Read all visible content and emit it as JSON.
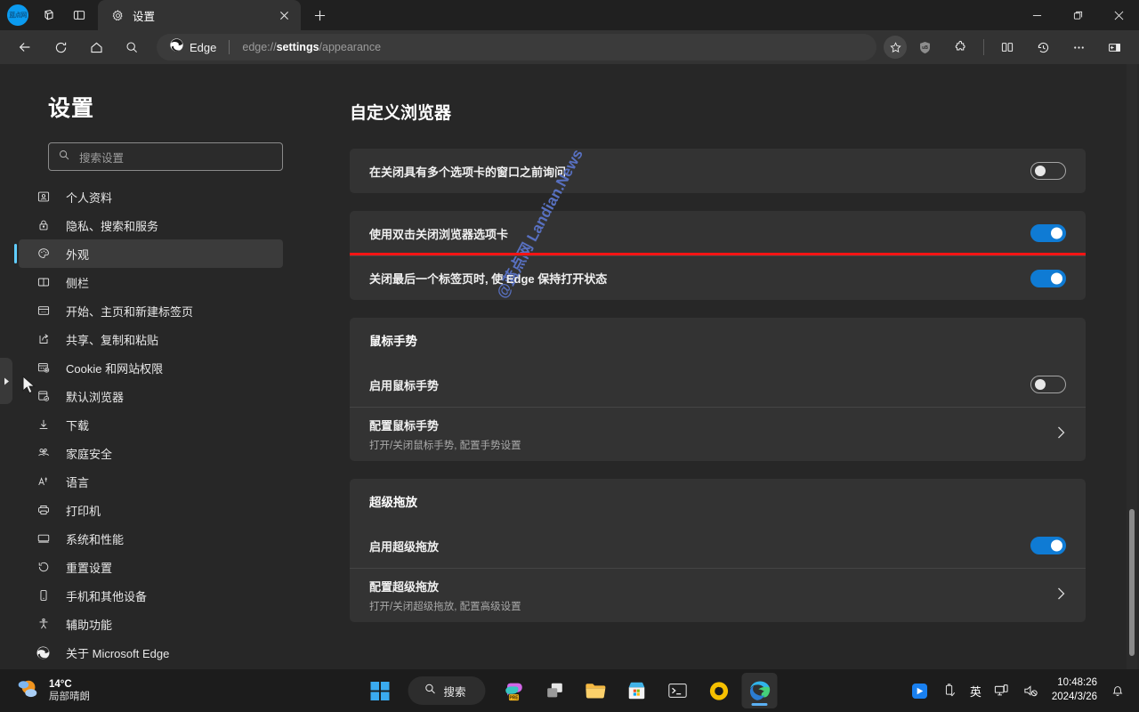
{
  "window": {
    "tab": {
      "title": "设置",
      "favicon_icon": "gear-icon",
      "close_icon": "close-icon"
    },
    "new_tab_icon": "plus-icon",
    "workspaces_icon": "workspaces-icon",
    "tab_actions_icon": "tab-actions-icon",
    "avatar_text": "蓝点网",
    "controls": {
      "minimize": "minimize-icon",
      "maximize": "maximize-icon",
      "close": "close-icon"
    }
  },
  "toolbar": {
    "back_icon": "back-arrow-icon",
    "refresh_icon": "refresh-icon",
    "home_icon": "home-icon",
    "search_icon": "search-icon",
    "omnibox": {
      "badge_icon": "edge-logo-icon",
      "badge_text": "Edge",
      "url_prefix": "edge://",
      "url_bold": "settings",
      "url_suffix": "/appearance",
      "favorite_icon": "star-icon"
    },
    "right_icons": [
      {
        "name": "ublock-icon",
        "label": "uB"
      },
      {
        "name": "extensions-puzzle-icon",
        "label": ""
      },
      {
        "name": "split-screen-icon",
        "label": ""
      },
      {
        "name": "history-icon",
        "label": ""
      },
      {
        "name": "more-options-icon",
        "label": ""
      },
      {
        "name": "sidebar-toggle-icon",
        "label": ""
      }
    ]
  },
  "sidebar": {
    "title": "设置",
    "search": {
      "placeholder": "搜索设置",
      "value": "",
      "icon": "search-icon"
    },
    "items": [
      {
        "label": "个人资料",
        "icon": "profile-icon",
        "active": false
      },
      {
        "label": "隐私、搜索和服务",
        "icon": "lock-icon",
        "active": false
      },
      {
        "label": "外观",
        "icon": "palette-icon",
        "active": true
      },
      {
        "label": "侧栏",
        "icon": "sidebar-panel-icon",
        "active": false
      },
      {
        "label": "开始、主页和新建标签页",
        "icon": "start-home-icon",
        "active": false
      },
      {
        "label": "共享、复制和粘贴",
        "icon": "share-icon",
        "active": false
      },
      {
        "label": "Cookie 和网站权限",
        "icon": "cookie-settings-icon",
        "active": false
      },
      {
        "label": "默认浏览器",
        "icon": "default-browser-icon",
        "active": false
      },
      {
        "label": "下载",
        "icon": "download-icon",
        "active": false
      },
      {
        "label": "家庭安全",
        "icon": "family-safety-icon",
        "active": false
      },
      {
        "label": "语言",
        "icon": "language-icon",
        "active": false
      },
      {
        "label": "打印机",
        "icon": "printer-icon",
        "active": false
      },
      {
        "label": "系统和性能",
        "icon": "system-performance-icon",
        "active": false
      },
      {
        "label": "重置设置",
        "icon": "reset-icon",
        "active": false
      },
      {
        "label": "手机和其他设备",
        "icon": "phone-devices-icon",
        "active": false
      },
      {
        "label": "辅助功能",
        "icon": "accessibility-icon",
        "active": false
      },
      {
        "label": "关于 Microsoft Edge",
        "icon": "edge-logo-icon",
        "active": false
      }
    ],
    "flyout_icon": "chevron-right-icon"
  },
  "main": {
    "title": "自定义浏览器",
    "watermark": "@蓝点网 Landian.News",
    "cards": [
      {
        "rows": [
          {
            "type": "toggle",
            "label": "在关闭具有多个选项卡的窗口之前询问",
            "state": "off",
            "highlight": false
          }
        ]
      },
      {
        "rows": [
          {
            "type": "toggle",
            "label": "使用双击关闭浏览器选项卡",
            "state": "on",
            "highlight": false
          },
          {
            "type": "toggle",
            "label": "关闭最后一个标签页时, 使 Edge 保持打开状态",
            "state": "on",
            "highlight": true
          }
        ]
      },
      {
        "rows": [
          {
            "type": "header",
            "label": "鼠标手势"
          },
          {
            "type": "toggle",
            "label": "启用鼠标手势",
            "state": "off",
            "highlight": false
          },
          {
            "type": "link",
            "label": "配置鼠标手势",
            "sublabel": "打开/关闭鼠标手势, 配置手势设置",
            "chevron_icon": "chevron-right-icon"
          }
        ]
      },
      {
        "rows": [
          {
            "type": "header",
            "label": "超级拖放"
          },
          {
            "type": "toggle",
            "label": "启用超级拖放",
            "state": "on",
            "highlight": false
          },
          {
            "type": "link",
            "label": "配置超级拖放",
            "sublabel": "打开/关闭超级拖放, 配置高级设置",
            "chevron_icon": "chevron-right-icon"
          }
        ]
      }
    ]
  },
  "taskbar": {
    "weather": {
      "temperature": "14°C",
      "description": "局部晴朗",
      "icon": "partly-sunny-icon"
    },
    "start_icon": "windows-start-icon",
    "search": {
      "label": "搜索",
      "icon": "search-icon"
    },
    "apps": [
      {
        "name": "copilot-icon",
        "active": false
      },
      {
        "name": "task-view-icon",
        "active": false
      },
      {
        "name": "file-explorer-icon",
        "active": false
      },
      {
        "name": "microsoft-store-icon",
        "active": false
      },
      {
        "name": "terminal-icon",
        "active": false
      },
      {
        "name": "chromium-icon",
        "active": false
      },
      {
        "name": "edge-icon",
        "active": true
      }
    ],
    "tray": [
      {
        "name": "tray-app-icon"
      },
      {
        "name": "usb-eject-icon"
      },
      {
        "name": "ime-indicator",
        "label": "英"
      },
      {
        "name": "network-icon"
      },
      {
        "name": "volume-muted-icon"
      }
    ],
    "clock": {
      "time": "10:48:26",
      "date": "2024/3/26"
    },
    "notification_icon": "bell-icon"
  },
  "colors": {
    "accent_blue": "#0f7bd4",
    "highlight_red": "#f71414",
    "active_nav": "#60cdff",
    "watermark": "#5a74c8"
  }
}
